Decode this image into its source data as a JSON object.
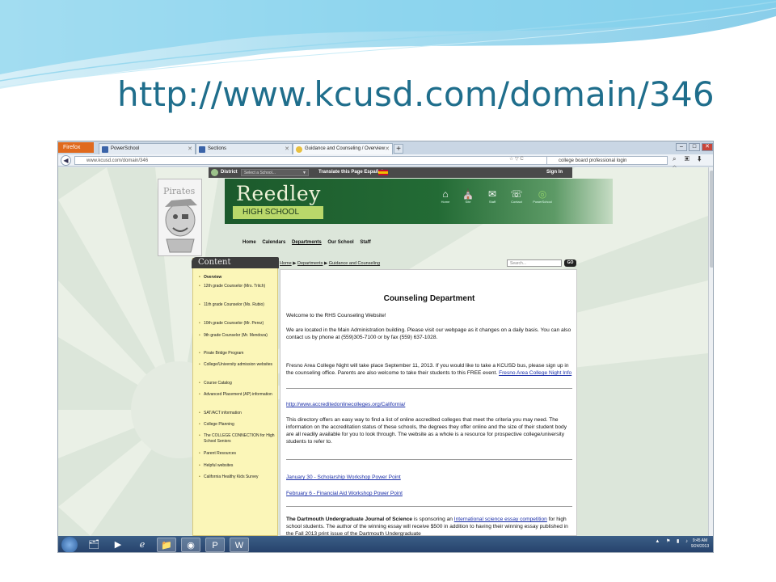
{
  "slide": {
    "title": "http://www.kcusd.com/domain/346"
  },
  "browser": {
    "menu_button": "Firefox",
    "tabs": [
      {
        "label": "PowerSchool"
      },
      {
        "label": "Sections"
      },
      {
        "label": "Guidance and Counseling / Overview",
        "active": true
      }
    ],
    "new_tab": "+",
    "url": "www.kcusd.com/domain/346",
    "search_value": "college board professional login"
  },
  "site_toolbar": {
    "district": "District",
    "select_placeholder": "Select a School...",
    "translate": "Translate this Page Español",
    "sign_in": "Sign In"
  },
  "banner": {
    "school_name": "Reedley",
    "school_sub": "HIGH SCHOOL",
    "mascot_text": "Pirates",
    "icons": [
      {
        "icon": "home-icon",
        "label": "Home"
      },
      {
        "icon": "school-icon",
        "label": "Site"
      },
      {
        "icon": "mail-icon",
        "label": "Staff"
      },
      {
        "icon": "contact-icon",
        "label": "Contact"
      },
      {
        "icon": "powerschool-icon",
        "label": "PowerSchool"
      }
    ]
  },
  "main_nav": [
    "Home",
    "Calendars",
    "Departments",
    "Our School",
    "Staff"
  ],
  "sidebar": {
    "heading": "Content",
    "items": [
      "Overview",
      "12th grade Counselor (Mrs. Tritch)",
      "11th grade Counselor (Ms. Rubio)",
      "10th grade Counselor (Mr. Perez)",
      "9th grade Counselor (Mr. Mendoza)",
      "Pirate Bridge Program",
      "College/University admission websites",
      "Course Catalog",
      "Advanced Placement (AP) information",
      "SAT/ACT information",
      "College Planning",
      "The COLLEGE CONNECTION for High School Seniors",
      "Parent Resources",
      "Helpful websites",
      "California Healthy Kids Survey"
    ]
  },
  "breadcrumb": {
    "home": "Home",
    "sep": "▶",
    "departments": "Departments",
    "current": "Guidance and Counseling"
  },
  "page_search": {
    "placeholder": "Search...",
    "go": "GO"
  },
  "content": {
    "heading": "Counseling Department",
    "welcome": "Welcome to the RHS Counseling Website!",
    "location": "We are located in the Main Administration building. Please visit our webpage as it changes on a daily basis. You can also contact us by phone at (559)305-7100 or by fax (559) 637-1028.",
    "fresno_text": "Fresno Area College Night will take place September 11, 2013. If you would like to take a KCUSD bus, please sign up in the counseling office. Parents are also welcome to take their students to this FREE event.",
    "fresno_link": "Fresno Area College Night Info",
    "directory_link": "http://www.accreditedonlinecolleges.org/California/",
    "directory_text": "This directory offers an easy way to find a list of online accredited colleges that meet the criteria you may need. The information on the accreditation status of these schools, the degrees they offer online and the size of their student body are all readily available for you to look through. The website as a whole is a resource for prospective college/university students to refer to.",
    "link_scholarship": "January 30 - Scholarship Workshop Power Point",
    "link_finaid": "February 6 - Financial Aid Workshop Power Point",
    "dartmouth_bold": "The Dartmouth Undergraduate Journal of Science",
    "dartmouth_mid": " is sponsoring an ",
    "dartmouth_link": "International science essay competition",
    "dartmouth_rest": " for high school students.  The author of the winning essay will receive $500 in addition to having their winning essay published in the Fall 2013 print issue of the Dartmouth Undergraduate"
  },
  "taskbar": {
    "clock_time": "9:45 AM",
    "clock_date": "9/24/2013",
    "apps": [
      "explorer-icon",
      "media-player-icon",
      "ie-icon",
      "folder-icon",
      "firefox-icon",
      "powerpoint-icon",
      "word-icon"
    ]
  }
}
